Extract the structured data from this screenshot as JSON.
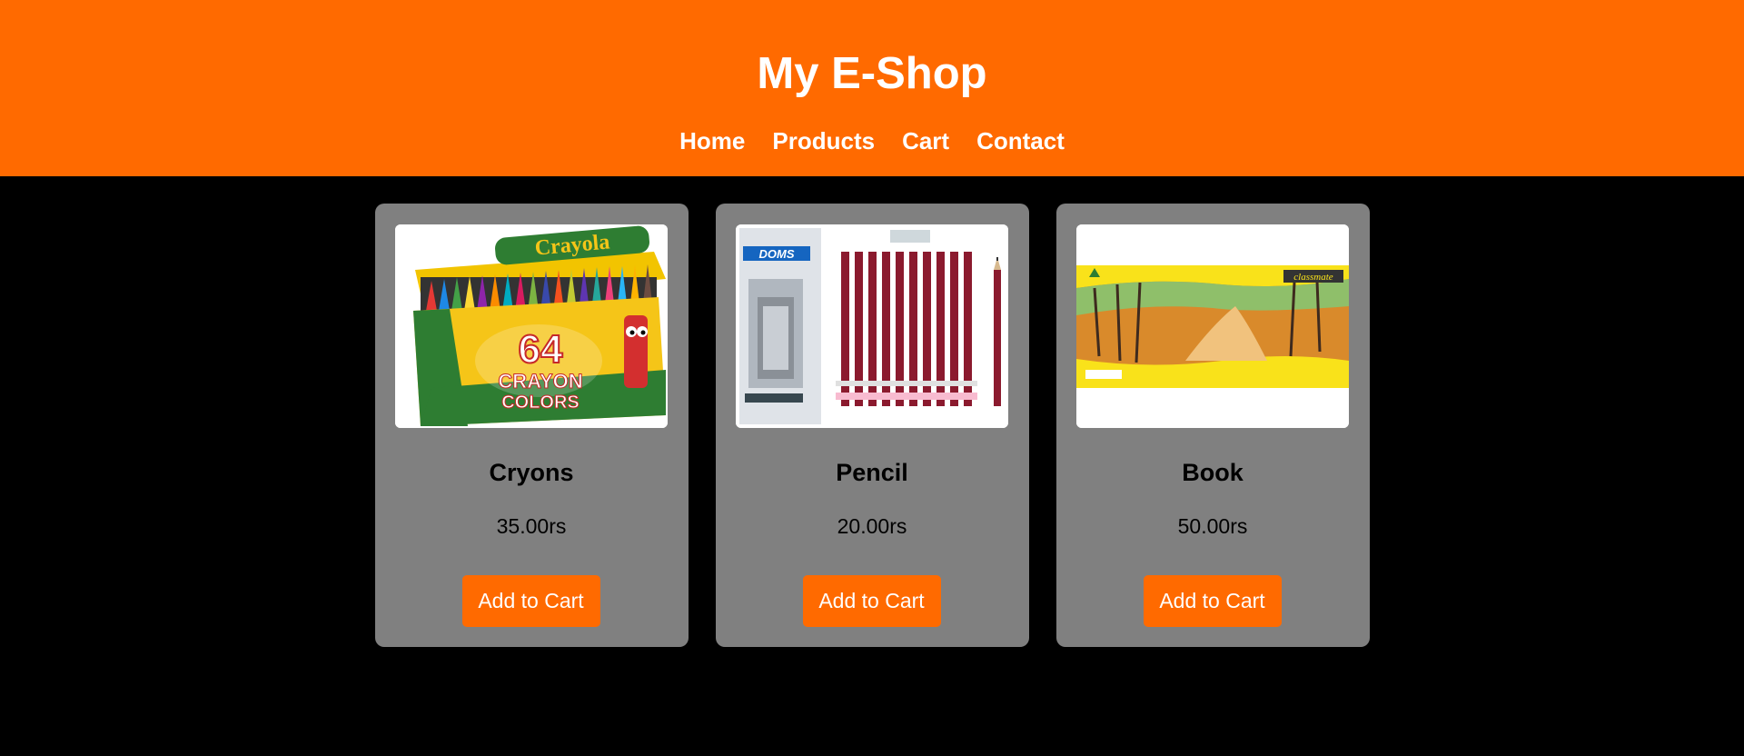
{
  "header": {
    "title": "My E-Shop",
    "nav": [
      "Home",
      "Products",
      "Cart",
      "Contact"
    ]
  },
  "colors": {
    "accent": "#ff6a00",
    "page_background": "#000000",
    "card_background": "#808080"
  },
  "products": [
    {
      "name": "Cryons",
      "price": "35.00rs",
      "button": "Add to Cart",
      "image": {
        "brand": "Crayola",
        "big": "64",
        "line1": "CRAYON",
        "line2": "COLORS"
      }
    },
    {
      "name": "Pencil",
      "price": "20.00rs",
      "button": "Add to Cart",
      "image": {
        "brand": "DOMS"
      }
    },
    {
      "name": "Book",
      "price": "50.00rs",
      "button": "Add to Cart",
      "image": {
        "brand": "classmate"
      }
    }
  ]
}
